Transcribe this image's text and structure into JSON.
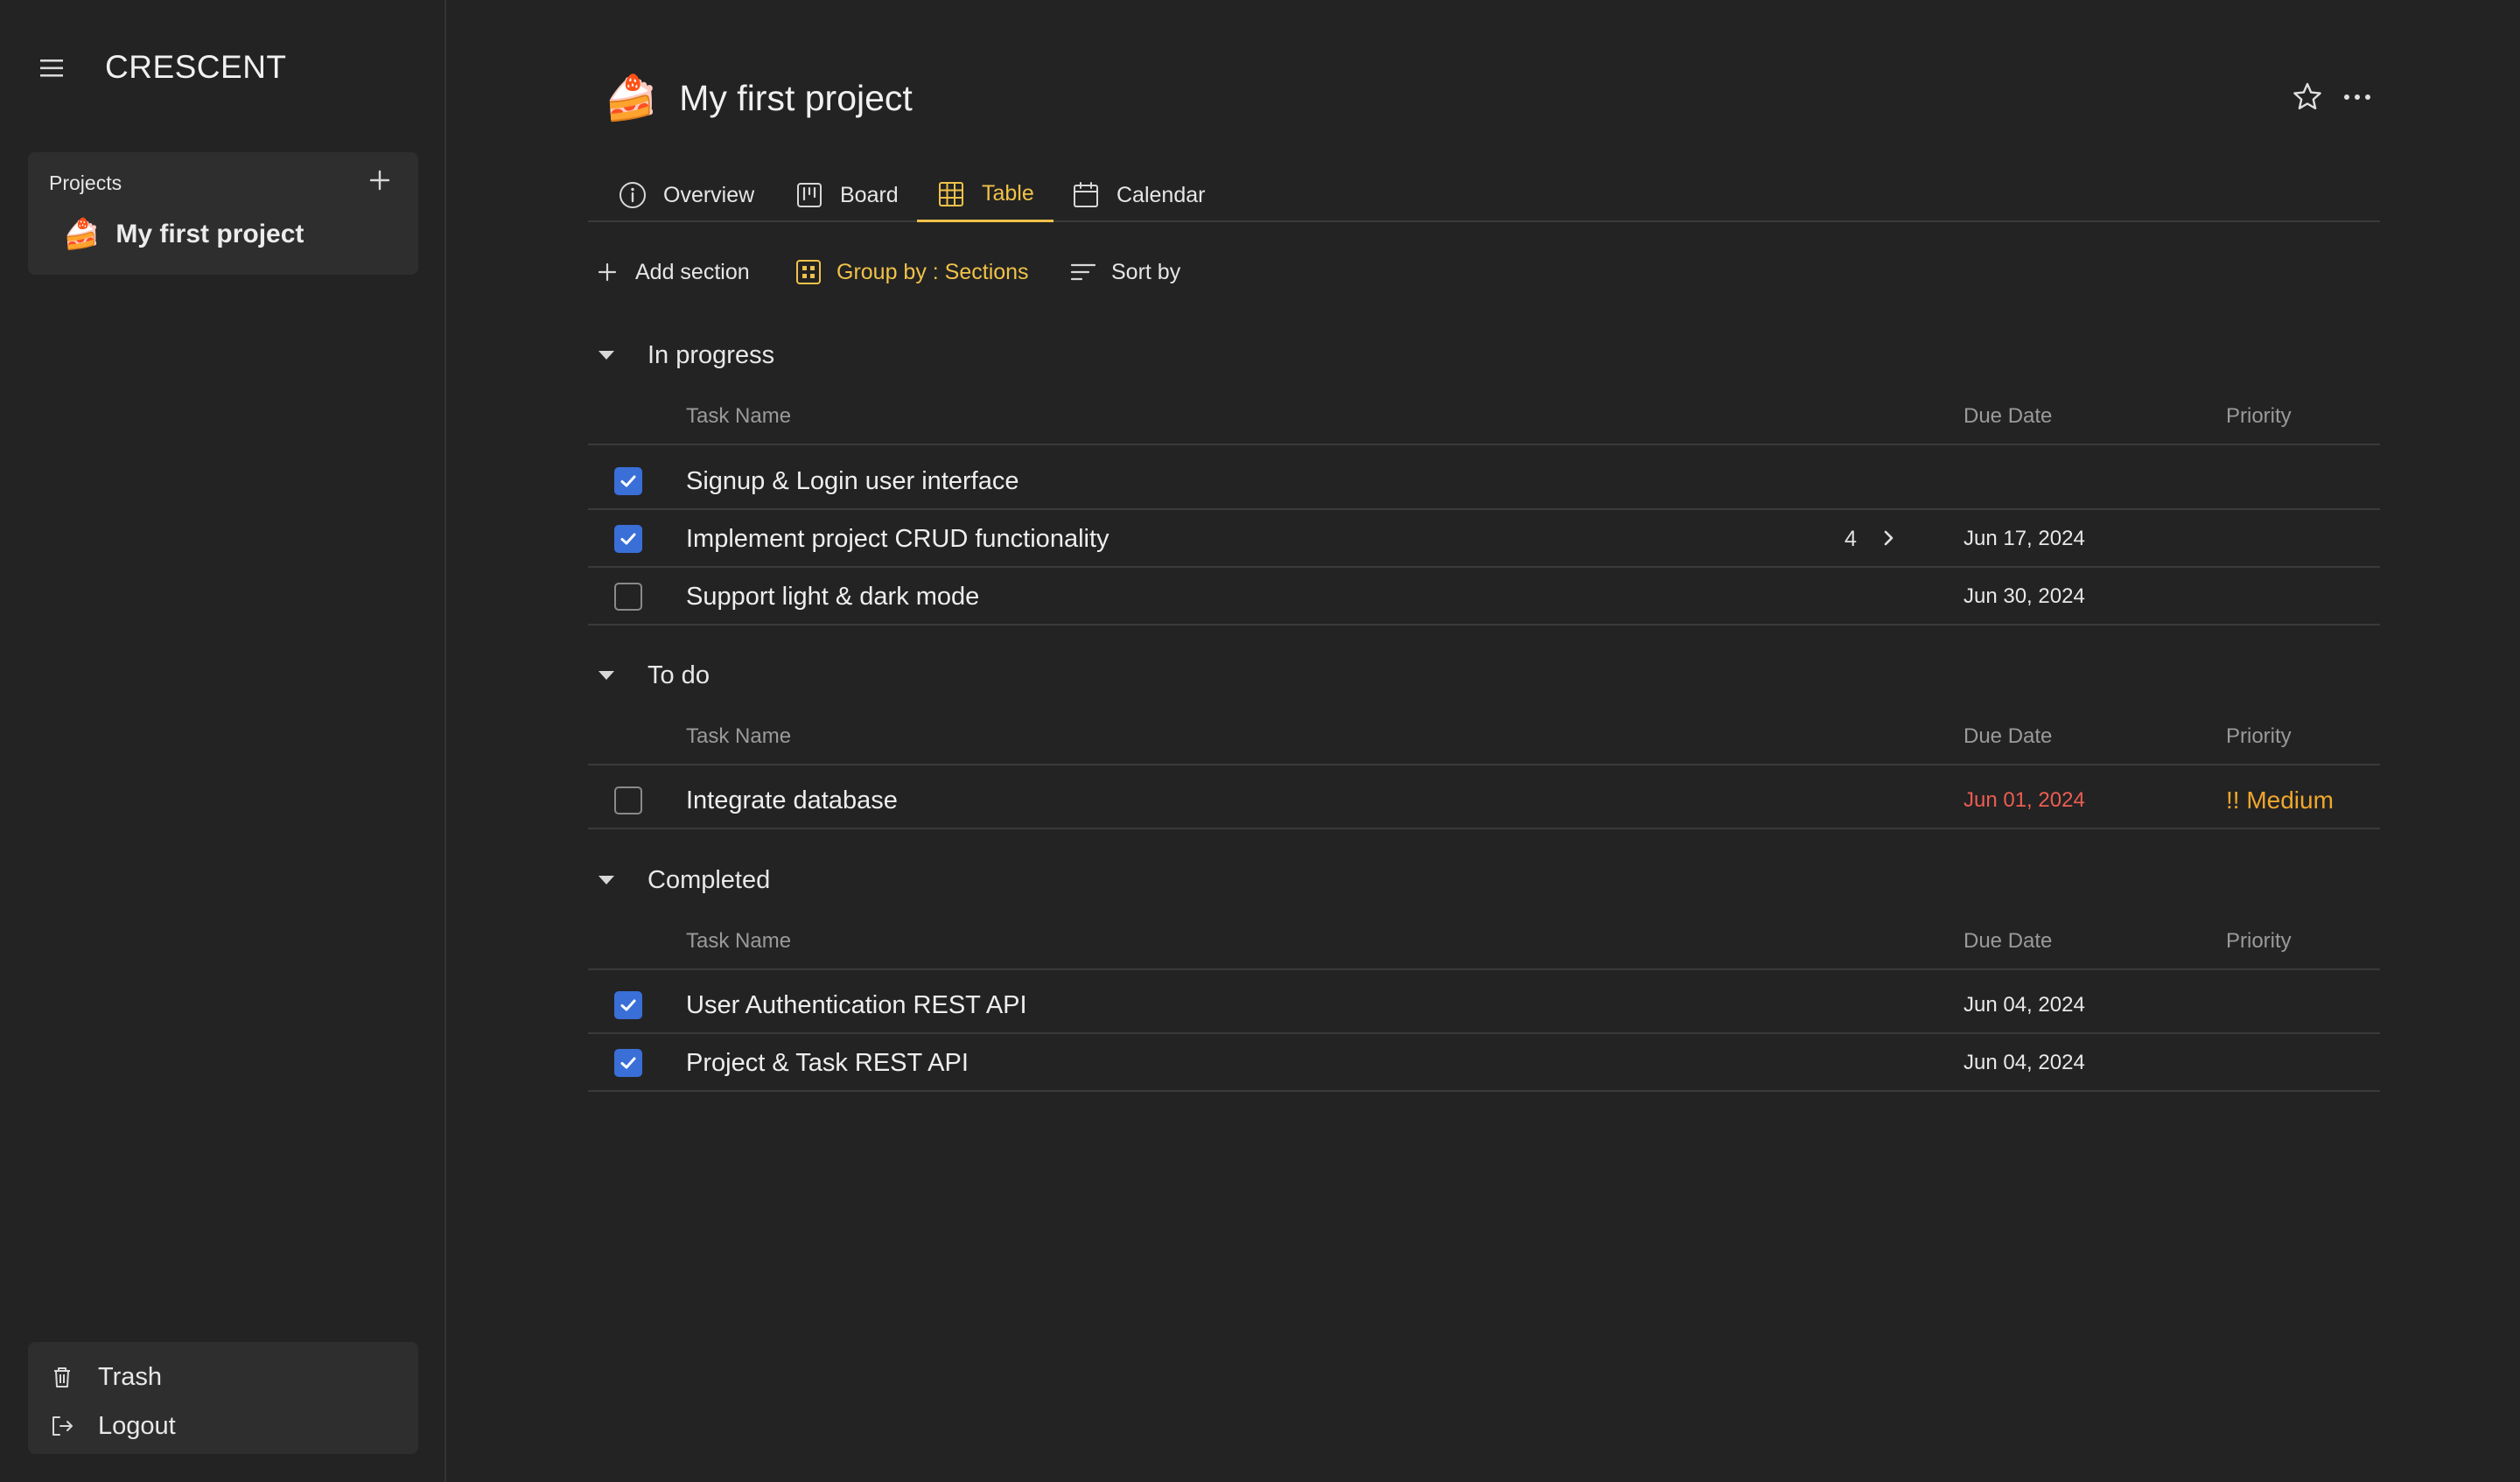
{
  "app": {
    "brand": "CRESCENT"
  },
  "sidebar": {
    "projects_heading": "Projects",
    "projects": [
      {
        "emoji": "🍰",
        "name": "My first project"
      }
    ],
    "bottom": {
      "trash_label": "Trash",
      "logout_label": "Logout"
    }
  },
  "page": {
    "emoji": "🍰",
    "title": "My first project"
  },
  "tabs": [
    {
      "label": "Overview",
      "icon": "info-circle-icon"
    },
    {
      "label": "Board",
      "icon": "board-icon"
    },
    {
      "label": "Table",
      "icon": "table-icon",
      "active": true
    },
    {
      "label": "Calendar",
      "icon": "calendar-icon"
    }
  ],
  "toolbar": {
    "add_section": "Add section",
    "group_by": "Group by : Sections",
    "sort_by": "Sort by"
  },
  "columns": {
    "task_name": "Task Name",
    "due_date": "Due Date",
    "priority": "Priority"
  },
  "sections": [
    {
      "title": "In progress",
      "tasks": [
        {
          "name": "Signup & Login user interface",
          "checked": true,
          "due": "",
          "priority": ""
        },
        {
          "name": "Implement project CRUD functionality",
          "checked": true,
          "subtasks": "4",
          "due": "Jun 17, 2024",
          "priority": ""
        },
        {
          "name": "Support light & dark mode",
          "checked": false,
          "due": "Jun 30, 2024",
          "priority": ""
        }
      ]
    },
    {
      "title": "To do",
      "tasks": [
        {
          "name": "Integrate database",
          "checked": false,
          "due": "Jun 01, 2024",
          "overdue": true,
          "priority": "!! Medium"
        }
      ]
    },
    {
      "title": "Completed",
      "tasks": [
        {
          "name": "User Authentication REST API",
          "checked": true,
          "due": "Jun 04, 2024",
          "priority": ""
        },
        {
          "name": "Project & Task REST API",
          "checked": true,
          "due": "Jun 04, 2024",
          "priority": ""
        }
      ]
    }
  ],
  "colors": {
    "background": "#232323",
    "panel": "#2e2e2e",
    "accent": "#f0c24a",
    "checkbox": "#3a6fd8",
    "overdue": "#ec5d52",
    "priority_medium": "#f0a72c"
  }
}
